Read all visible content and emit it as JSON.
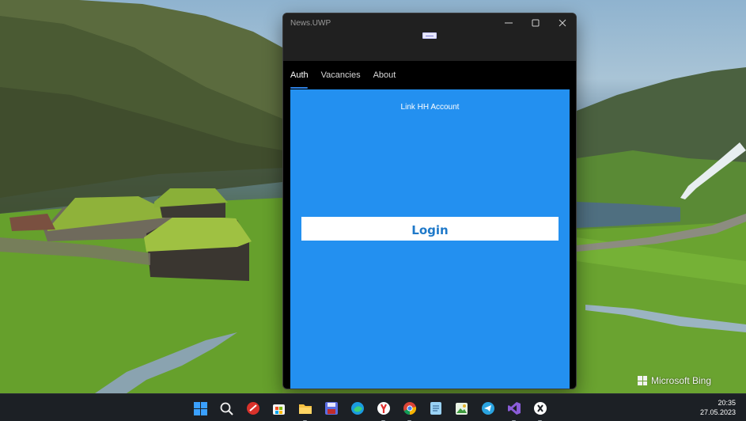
{
  "window": {
    "title": "News.UWP",
    "caption": {
      "minimize": "minimize-icon",
      "maximize": "maximize-icon",
      "close": "close-icon"
    }
  },
  "tabs": [
    {
      "label": "Auth",
      "active": true
    },
    {
      "label": "Vacancies",
      "active": false
    },
    {
      "label": "About",
      "active": false
    }
  ],
  "auth": {
    "link_text": "Link HH Account",
    "login_label": "Login"
  },
  "desktop": {
    "watermark": "Microsoft Bing"
  },
  "taskbar": {
    "icons": [
      "start-icon",
      "search-icon",
      "app-red-icon",
      "store-icon",
      "file-explorer-icon",
      "floppy-app-icon",
      "edge-icon",
      "yandex-browser-icon",
      "chrome-icon",
      "notepad-icon",
      "image-editor-icon",
      "telegram-icon",
      "visual-studio-icon",
      "xamarin-icon"
    ],
    "time": "20:35",
    "date": "27.05.2023"
  },
  "colors": {
    "content_background": "#2390f0",
    "login_text": "#1f79c9",
    "tab_indicator": "#2d7fe0",
    "titlebar": "#202020"
  }
}
